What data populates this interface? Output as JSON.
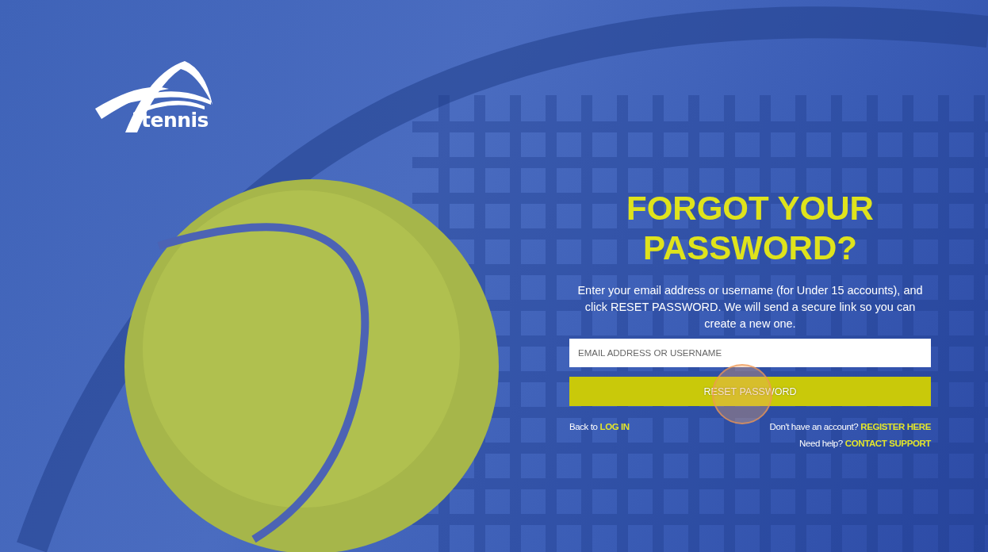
{
  "logo": {
    "text": "tennis"
  },
  "title": "FORGOT YOUR PASSWORD?",
  "instructions": "Enter your email address or username (for Under 15 accounts), and click RESET PASSWORD. We will send a secure link so you can create a new one.",
  "field": {
    "placeholder": "EMAIL ADDRESS OR USERNAME"
  },
  "reset_button": "RESET PASSWORD",
  "links": {
    "back": {
      "prefix": "Back to",
      "link": "LOG IN"
    },
    "register": {
      "prefix": "Don't have an account?",
      "link": "REGISTER HERE"
    },
    "help": {
      "prefix": "Need help?",
      "link": "CONTACT SUPPORT"
    }
  }
}
